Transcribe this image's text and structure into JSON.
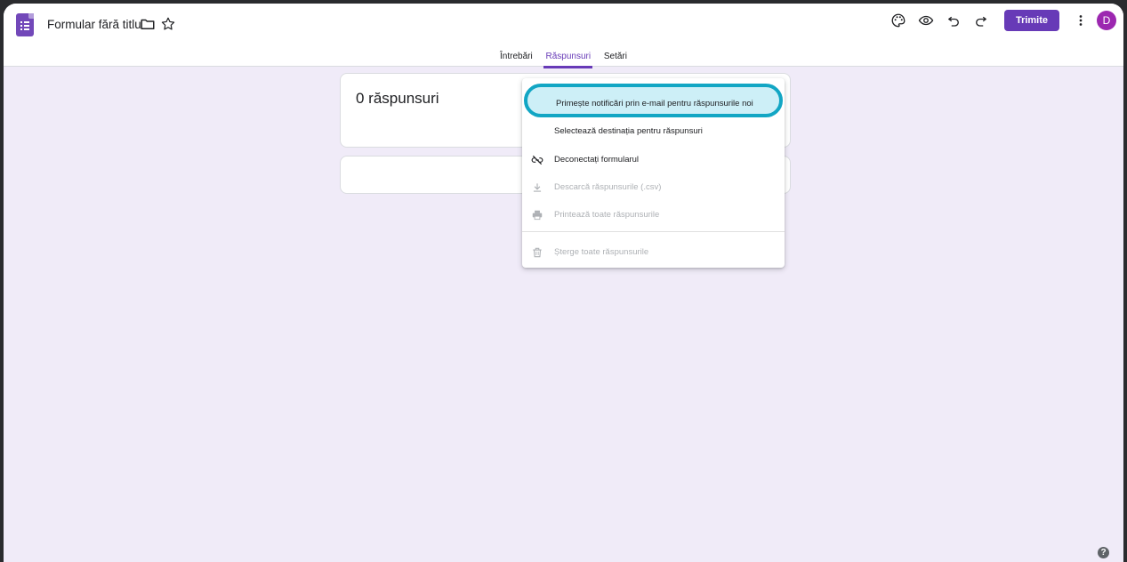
{
  "header": {
    "title": "Formular fără titlu",
    "send_label": "Trimite",
    "avatar_letter": "D"
  },
  "tabs": [
    {
      "label": "Întrebări",
      "active": false
    },
    {
      "label": "Răspunsuri",
      "active": true
    },
    {
      "label": "Setări",
      "active": false
    }
  ],
  "responses": {
    "count_label": "0 răspunsuri"
  },
  "menu": {
    "items": [
      {
        "label": "Primește notificări prin e-mail pentru răspunsurile noi",
        "enabled": true,
        "icon": "none",
        "highlighted": true
      },
      {
        "label": "Selectează destinația pentru răspunsuri",
        "enabled": true,
        "icon": "none"
      },
      {
        "label": "Deconectați formularul",
        "enabled": true,
        "icon": "link-off-icon"
      },
      {
        "label": "Descarcă răspunsurile (.csv)",
        "enabled": false,
        "icon": "download-icon"
      },
      {
        "label": "Printează toate răspunsurile",
        "enabled": false,
        "icon": "print-icon"
      },
      {
        "label": "Șterge toate răspunsurile",
        "enabled": false,
        "icon": "trash-icon"
      }
    ]
  },
  "colors": {
    "accent": "#673ab7",
    "background": "#f0ebf8",
    "highlight_border": "#12a6c4",
    "highlight_fill": "#cdeff7"
  }
}
